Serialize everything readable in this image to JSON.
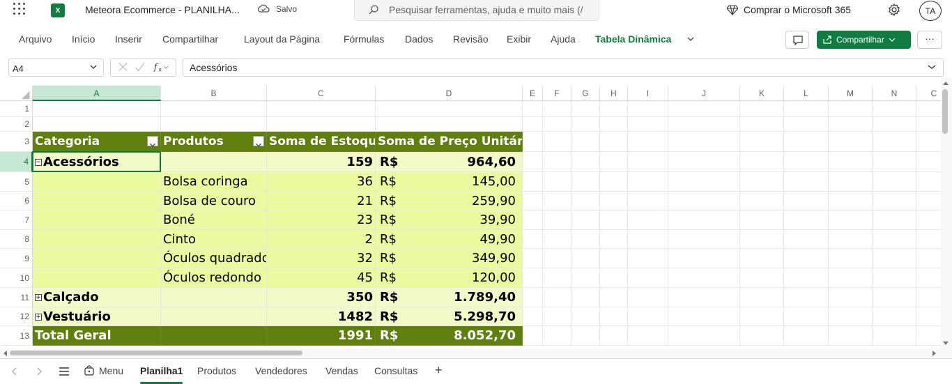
{
  "titlebar": {
    "doc_title": "Meteora Ecommerce - PLANILHA...",
    "save_status": "Salvo",
    "search_placeholder": "Pesquisar ferramentas, ajuda e muito mais (/",
    "buy_label": "Comprar o Microsoft 365",
    "avatar_initials": "TA",
    "app_icon_letter": "X"
  },
  "ribbon": {
    "tabs": [
      "Arquivo",
      "Início",
      "Inserir",
      "Compartilhar",
      "Layout da Página",
      "Fórmulas",
      "Dados",
      "Revisão",
      "Exibir",
      "Ajuda",
      "Tabela Dinâmica"
    ],
    "share_label": "Compartilhar",
    "more_label": "···"
  },
  "formula_bar": {
    "name_box": "A4",
    "formula": "Acessórios"
  },
  "columns": [
    "A",
    "B",
    "C",
    "D",
    "E",
    "F",
    "G",
    "H",
    "I",
    "J",
    "K",
    "L",
    "M",
    "N",
    "C"
  ],
  "rows": [
    "1",
    "2",
    "3",
    "4",
    "5",
    "6",
    "7",
    "8",
    "9",
    "10",
    "11",
    "12",
    "13"
  ],
  "pivot": {
    "headers": [
      "Categoria",
      "Produtos",
      "Soma de Estoque",
      "Soma de Preço Unitário"
    ],
    "currency": "R$",
    "groups": [
      {
        "category": "Acessórios",
        "toggle": "⊟",
        "stock": "159",
        "price": "964,60"
      },
      {
        "category": "Calçado",
        "toggle": "⊞",
        "stock": "350",
        "price": "1.789,40"
      },
      {
        "category": "Vestuário",
        "toggle": "⊞",
        "stock": "1482",
        "price": "5.298,70"
      }
    ],
    "items": [
      {
        "product": "Bolsa coringa",
        "stock": "36",
        "price": "145,00"
      },
      {
        "product": "Bolsa de couro",
        "stock": "21",
        "price": "259,90"
      },
      {
        "product": "Boné",
        "stock": "23",
        "price": "39,90"
      },
      {
        "product": "Cinto",
        "stock": "2",
        "price": "49,90"
      },
      {
        "product": "Óculos quadrado",
        "stock": "32",
        "price": "349,90"
      },
      {
        "product": "Óculos redondo",
        "stock": "45",
        "price": "120,00"
      }
    ],
    "total": {
      "label": "Total Geral",
      "stock": "1991",
      "price": "8.052,70"
    }
  },
  "sheets": {
    "menu_label": "Menu",
    "tabs": [
      "Planilha1",
      "Produtos",
      "Vendedores",
      "Vendas",
      "Consultas"
    ],
    "add_label": "+"
  },
  "colors": {
    "accent": "#107c41",
    "pivot_header": "#5f7f0f",
    "pivot_group": "#f2fbc8",
    "pivot_item": "#ebfa9f"
  }
}
